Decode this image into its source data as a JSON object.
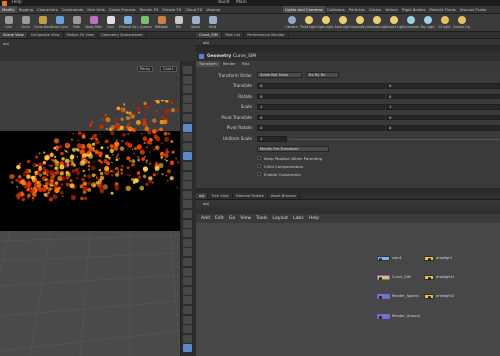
{
  "menubar": {
    "items": [
      "Help",
      "Build",
      "Main"
    ]
  },
  "shelf_left": {
    "tabs": [
      "Modify",
      "Rigging",
      "Characters",
      "Constraints",
      "Hair Utils",
      "Guide Process",
      "Terrain FX",
      "Simple FX",
      "Cloud FX",
      "Volume"
    ],
    "tools": [
      "Line",
      "Circle",
      "Curve Bezier",
      "Draw Curve",
      "Path",
      "Spray Paint",
      "Font",
      "Platonic Solids",
      "L-System",
      "Metaball",
      "File",
      "Spiral",
      "Helix"
    ]
  },
  "shelf_right": {
    "tabs": [
      "Lights and Cameras",
      "Collisions",
      "Particles",
      "Grains",
      "Vellum",
      "Rigid Bodies",
      "Particle Fluids",
      "Viscous Fluids"
    ],
    "tools": [
      "Camera",
      "Point Light",
      "Spot Light",
      "Area Light",
      "Geometry Light",
      "Volume Light",
      "Distant Light",
      "Environment Light",
      "Sky Light",
      "GI Light",
      "Caustic Light"
    ]
  },
  "left_pane": {
    "tabs": [
      "Scene View",
      "Composite View",
      "Motion FX View",
      "Geometry Spreadsheet"
    ],
    "path": "obj",
    "view_menus": [
      "Persp",
      "Cam1"
    ]
  },
  "right_pane": {
    "tabs": [
      "Curve_SIM",
      "Take List",
      "Performance Monitor"
    ],
    "path": "obj",
    "node_type": "Geometry",
    "node_name": "Curve_SIM",
    "param_tabs": [
      "Transform",
      "Render",
      "Misc"
    ],
    "transform_order": {
      "label": "Transform Order",
      "value1": "Scale Rot Trans",
      "value2": "Rx Ry Rz"
    },
    "params": [
      {
        "label": "Translate",
        "v": [
          "0",
          "0"
        ]
      },
      {
        "label": "Rotate",
        "v": [
          "0",
          "0"
        ]
      },
      {
        "label": "Scale",
        "v": [
          "1",
          "1"
        ]
      },
      {
        "label": "Pivot Translate",
        "v": [
          "0",
          "0"
        ]
      },
      {
        "label": "Pivot Rotate",
        "v": [
          "0",
          "0"
        ]
      }
    ],
    "uniform_scale": {
      "label": "Uniform Scale",
      "value": "1"
    },
    "modify": "Modify Pre-Transform",
    "checkboxes": [
      "Keep Position When Parenting",
      "Child Compensation",
      "Enable Constraints"
    ]
  },
  "network_pane": {
    "tabs": [
      "obj",
      "Tree View",
      "Material Palette",
      "Asset Browser"
    ],
    "path": "obj",
    "menu": [
      "Add",
      "Edit",
      "Go",
      "View",
      "Tools",
      "Layout",
      "Labs",
      "Help"
    ],
    "nodes": [
      {
        "name": "cam1",
        "kind": "camera"
      },
      {
        "name": "arealight",
        "kind": "light"
      },
      {
        "name": "Curve_SIM",
        "kind": "geo"
      },
      {
        "name": "arealight1",
        "kind": "light"
      },
      {
        "name": "Render_Sparks",
        "kind": "geo"
      },
      {
        "name": "arealight2",
        "kind": "light"
      },
      {
        "name": "Render_Ground",
        "kind": "geo"
      }
    ]
  },
  "colors": {
    "accent": "#e87a20",
    "selected_node": "#d9c94a",
    "node_blue": "#5a7fd8",
    "node_purple": "#8a5fc8",
    "light_yellow": "#e8c23a"
  }
}
